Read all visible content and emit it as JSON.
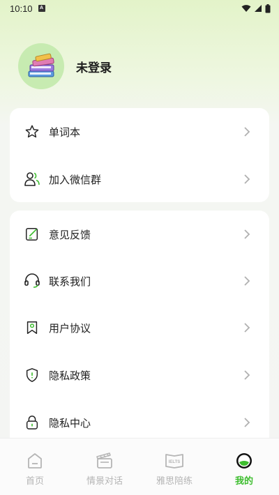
{
  "status_bar": {
    "time": "10:10",
    "notif_letter": "A"
  },
  "profile": {
    "login_text": "未登录"
  },
  "card1": {
    "items": [
      {
        "label": "单词本",
        "icon": "star-icon"
      },
      {
        "label": "加入微信群",
        "icon": "group-icon"
      }
    ]
  },
  "card2": {
    "items": [
      {
        "label": "意见反馈",
        "icon": "feedback-icon"
      },
      {
        "label": "联系我们",
        "icon": "headset-icon"
      },
      {
        "label": "用户协议",
        "icon": "bookmark-icon"
      },
      {
        "label": "隐私政策",
        "icon": "shield-icon"
      },
      {
        "label": "隐私中心",
        "icon": "lock-icon"
      }
    ]
  },
  "tabbar": {
    "items": [
      {
        "label": "首页",
        "icon": "home-icon",
        "active": false
      },
      {
        "label": "情景对话",
        "icon": "clapper-icon",
        "active": false
      },
      {
        "label": "雅思陪练",
        "icon": "ielts-book-icon",
        "active": false
      },
      {
        "label": "我的",
        "icon": "profile-icon",
        "active": true
      }
    ],
    "ielts_badge": "IELTS"
  },
  "colors": {
    "accent": "#3dbd2e",
    "avatar_bg": "#c7ebb1",
    "inactive": "#b5b5b5"
  }
}
